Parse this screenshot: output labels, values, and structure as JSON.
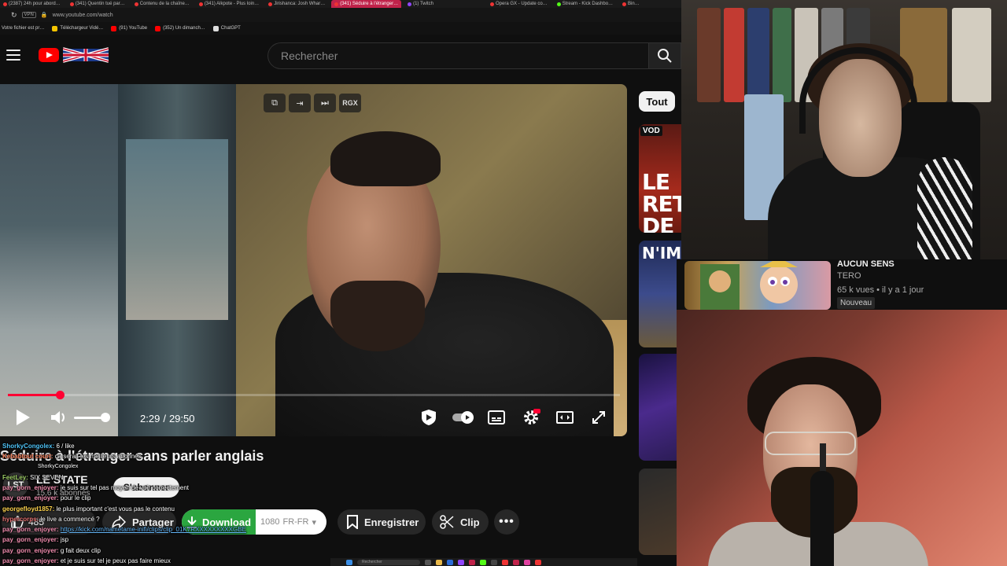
{
  "browser": {
    "tabs": [
      "(2387) 24h pour abord…",
      "(341) Quentin tué par…",
      "Contenu de la chaîne…",
      "(341) Alkpote - Plus loin…",
      "Jirishanca: Josh Whar…",
      "(341) Séduire à l'étranger…",
      "(1) Twitch",
      "Opera GX - Update co…",
      "Stream - Kick Dashbo…",
      "Bin…"
    ],
    "url": "www.youtube.com/watch",
    "bookmarks": [
      "Votre fichier est pr…",
      "Téléchargeur Vidé…",
      "(91) YouTube",
      "(352) Un dimanch…",
      "ChatGPT"
    ]
  },
  "header": {
    "search_placeholder": "Rechercher"
  },
  "player": {
    "overlay_buttons": [
      "RGX"
    ],
    "current_time": "2:29",
    "separator": "/",
    "duration": "29:50",
    "progress": 0.085,
    "volume": 0.85
  },
  "video": {
    "title": "Séduire à l'étranger sans parler anglais",
    "channel": "LE STATE",
    "channel_avatar": "LST",
    "subscribers": "15,6 k abonnés",
    "subscribe_label": "S'abonner",
    "likes": "485",
    "share_label": "Partager",
    "download_label": "Download",
    "download_quality": "1080",
    "download_lang": "FR-FR",
    "save_label": "Enregistrer",
    "clip_label": "Clip"
  },
  "chat": [
    {
      "user": "ShorkyCongolex:",
      "msg": "6 / like"
    },
    {
      "user": "Kebabtout court:",
      "msg": "ça serait les meilleurs abonnés"
    },
    {
      "user": "",
      "msg": "ShorkyCongolex"
    },
    {
      "user": "FeetLey:",
      "msg": "SIX SEVEN"
    },
    {
      "user": "pay_gorn_enjoyer:",
      "msg": "je suis sur tel pas moyen de voir correctement"
    },
    {
      "user": "pay_gorn_enjoyer:",
      "msg": "pour le clip"
    },
    {
      "user": "georgefloyd1857:",
      "msg": "le plus important c'est vous pas le contenu"
    },
    {
      "user": "hypercorps:",
      "msg": "le live a commencé ?"
    },
    {
      "user": "pay_gorn_enjoyer:",
      "msg": "https://kick.com/nametame-inifi/clips/clip_01K7RXXXXXXXXXGBE"
    },
    {
      "user": "pay_gorn_enjoyer:",
      "msg": "jsp"
    },
    {
      "user": "pay_gorn_enjoyer:",
      "msg": "g fait deux clip"
    },
    {
      "user": "pay_gorn_enjoyer:",
      "msg": "et je suis sur tel je peux pas faire mieux"
    }
  ],
  "recommendations": {
    "filter_chip": "Tout",
    "thumb1_badge": "VOD",
    "thumb1_text": "LE RET DE GA",
    "thumb2_text": "N'IMP",
    "featured": {
      "title": "AUCUN SENS",
      "channel": "TERO",
      "meta": "65 k vues • il y a 1 jour",
      "badge": "Nouveau"
    }
  },
  "taskbar": {
    "search": "Rechercher"
  },
  "colors": {
    "accent": "#ff0033",
    "download_green": "#2ba640",
    "background": "#0f0f0f"
  }
}
